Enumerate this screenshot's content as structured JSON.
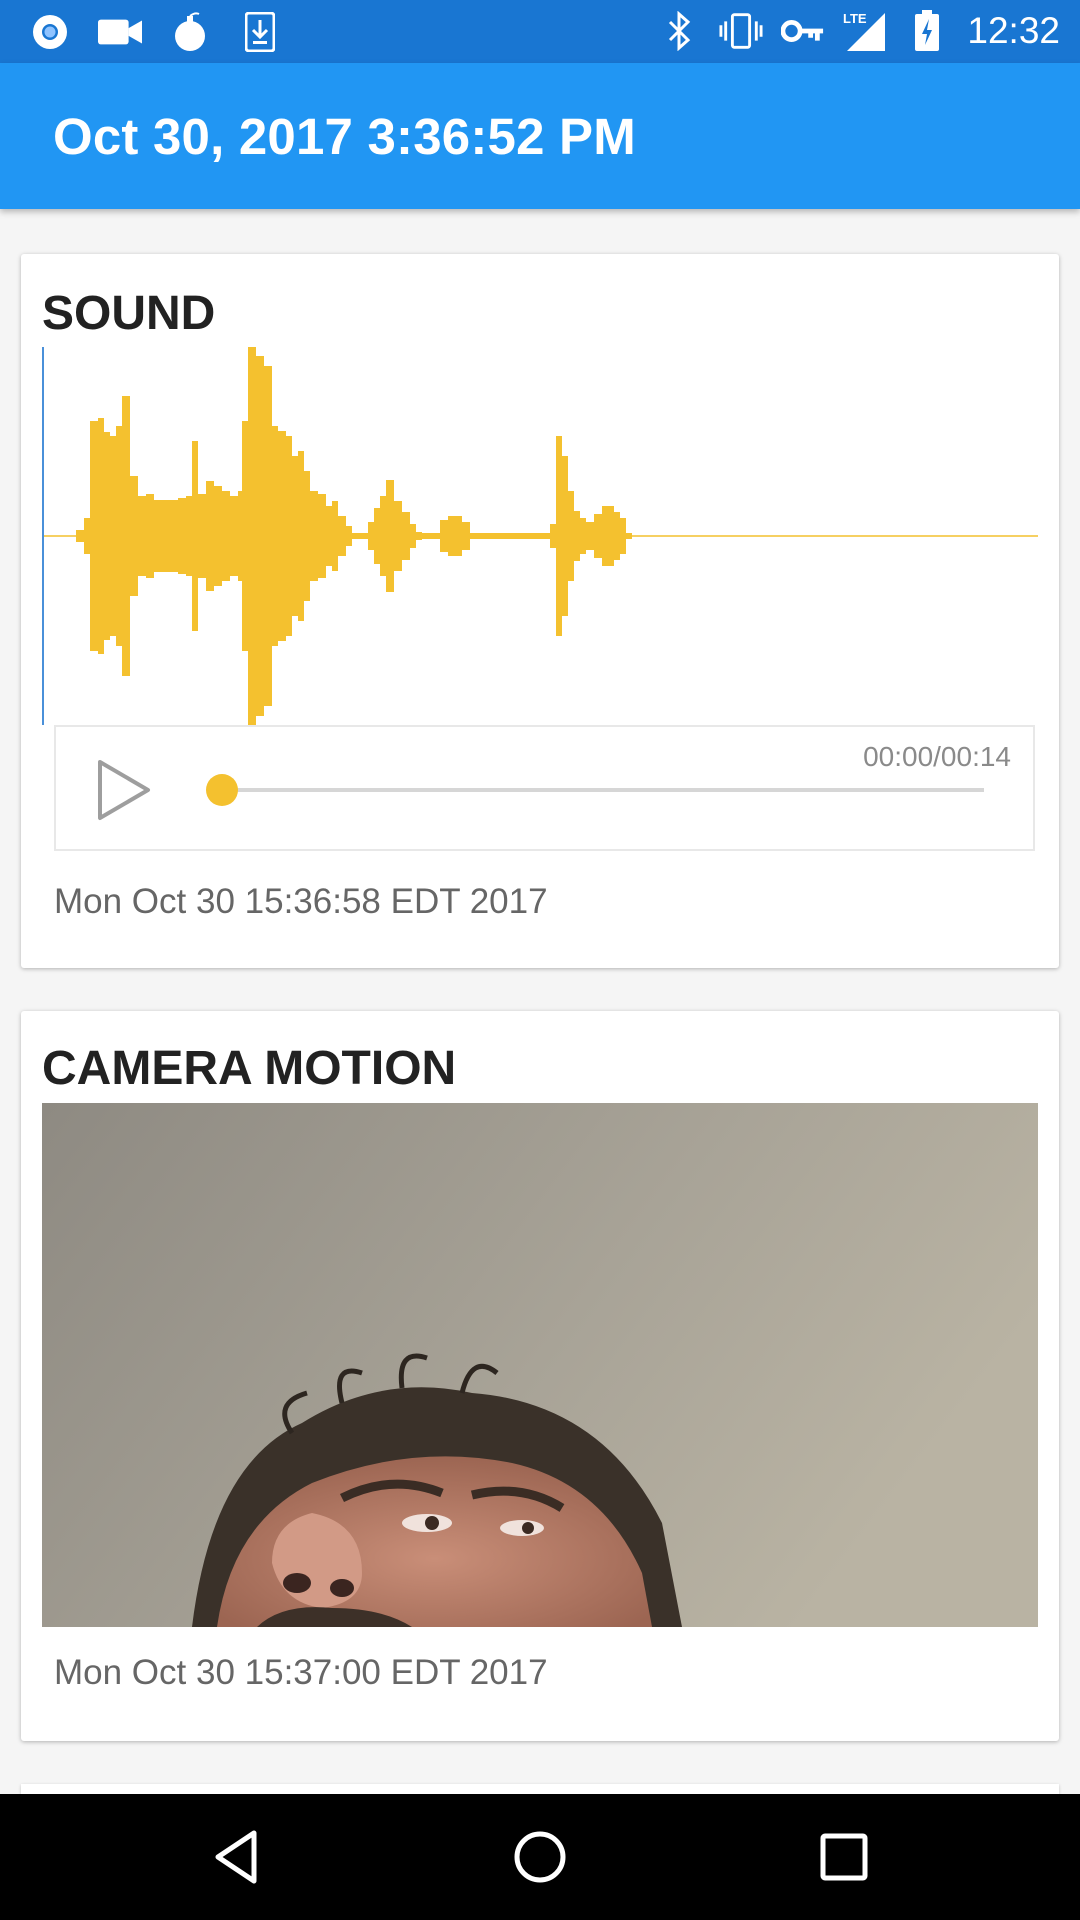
{
  "status_bar": {
    "time": "12:32",
    "network_type": "LTE",
    "left_icons": [
      "chrome-icon",
      "video-camera-icon",
      "bomb-icon",
      "download-icon"
    ],
    "right_icons": [
      "bluetooth-icon",
      "vibrate-icon",
      "vpn-key-icon",
      "cell-signal-icon",
      "battery-icon"
    ]
  },
  "app_bar": {
    "title": "Oct 30, 2017 3:36:52 PM",
    "color": "#2196F3"
  },
  "cards": {
    "sound": {
      "title": "SOUND",
      "player": {
        "time_display": "00:00/00:14",
        "progress": 0.0,
        "accent": "#F4C12F"
      },
      "timestamp": "Mon Oct 30 15:36:58 EDT 2017"
    },
    "camera": {
      "title": "CAMERA MOTION",
      "timestamp": "Mon Oct 30 15:37:00 EDT 2017"
    }
  },
  "nav_bar": {
    "buttons": [
      "back-icon",
      "home-icon",
      "recents-icon"
    ]
  }
}
